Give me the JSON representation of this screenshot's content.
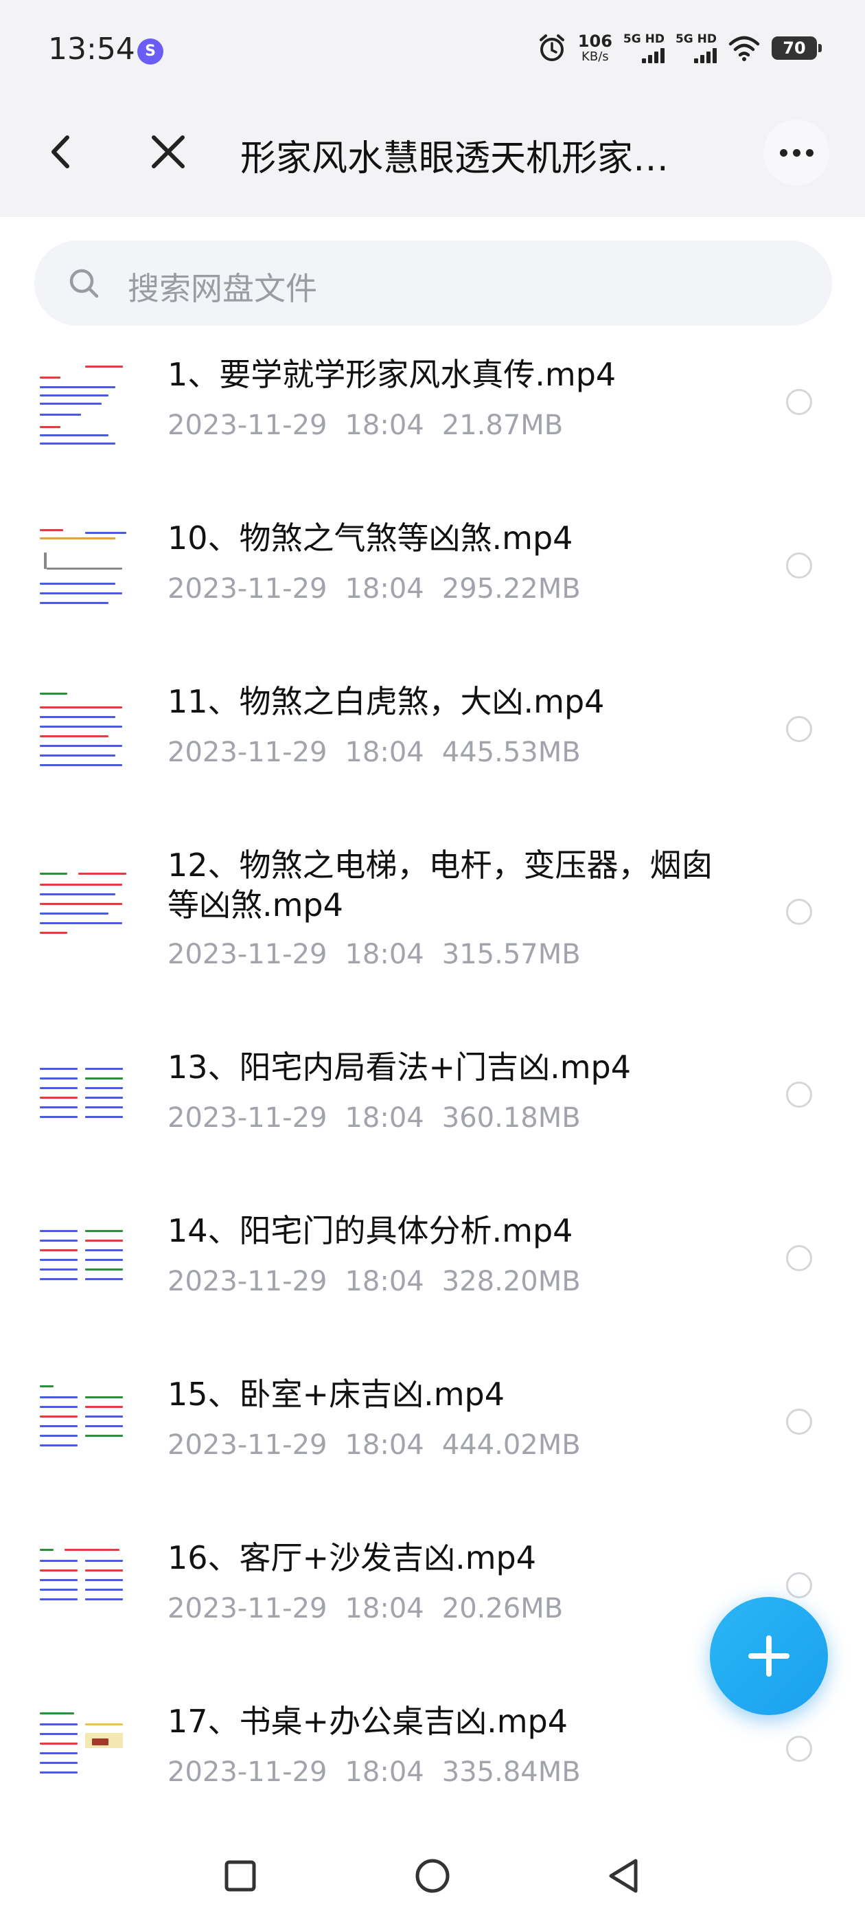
{
  "status_bar": {
    "time": "13:54",
    "app_badge": "S",
    "speed_value": "106",
    "speed_unit": "KB/s",
    "sim1_label": "5G HD",
    "sim2_label": "5G HD",
    "battery": "70"
  },
  "header": {
    "title": "形家风水慧眼透天机形家…"
  },
  "search": {
    "placeholder": "搜索网盘文件"
  },
  "files": [
    {
      "name": "1、要学就学形家风水真传.mp4",
      "date": "2023-11-29",
      "time": "18:04",
      "size": "21.87MB"
    },
    {
      "name": "10、物煞之气煞等凶煞.mp4",
      "date": "2023-11-29",
      "time": "18:04",
      "size": "295.22MB"
    },
    {
      "name": "11、物煞之白虎煞，大凶.mp4",
      "date": "2023-11-29",
      "time": "18:04",
      "size": "445.53MB"
    },
    {
      "name": "12、物煞之电梯，电杆，变压器，烟囱等凶煞.mp4",
      "date": "2023-11-29",
      "time": "18:04",
      "size": "315.57MB"
    },
    {
      "name": "13、阳宅内局看法+门吉凶.mp4",
      "date": "2023-11-29",
      "time": "18:04",
      "size": "360.18MB"
    },
    {
      "name": "14、阳宅门的具体分析.mp4",
      "date": "2023-11-29",
      "time": "18:04",
      "size": "328.20MB"
    },
    {
      "name": "15、卧室+床吉凶.mp4",
      "date": "2023-11-29",
      "time": "18:04",
      "size": "444.02MB"
    },
    {
      "name": "16、客厅+沙发吉凶.mp4",
      "date": "2023-11-29",
      "time": "18:04",
      "size": "20.26MB"
    },
    {
      "name": "17、书桌+办公桌吉凶.mp4",
      "date": "2023-11-29",
      "time": "18:04",
      "size": "335.84MB"
    }
  ]
}
